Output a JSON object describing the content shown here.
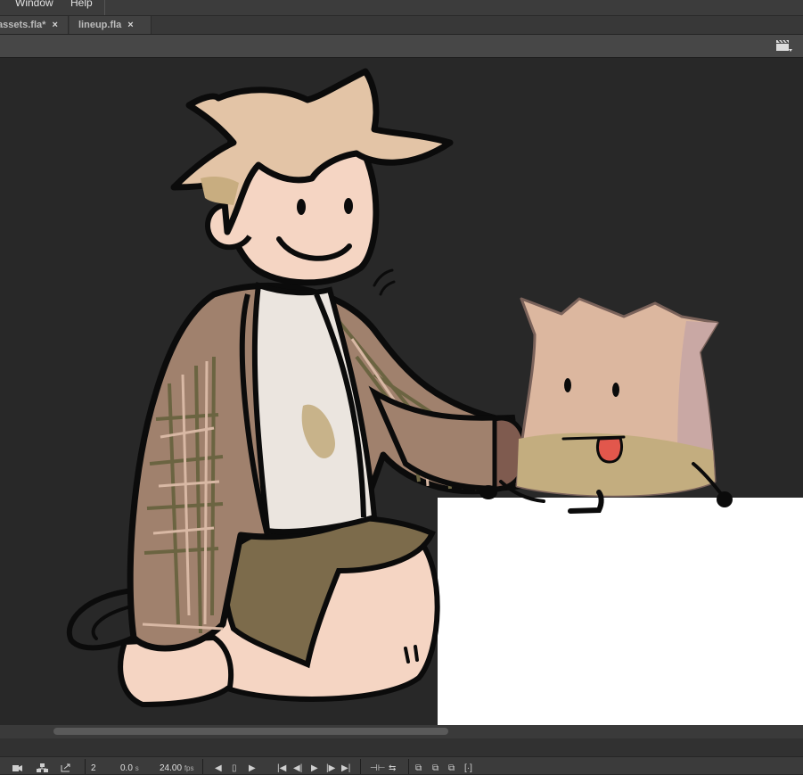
{
  "menu": {
    "items": [
      "Window",
      "Help"
    ]
  },
  "tabs": [
    {
      "label": "assets.fla*",
      "close": "×"
    },
    {
      "label": "lineup.fla",
      "close": "×"
    }
  ],
  "toolbar": {
    "clapper_icon": "movie-clapper-icon"
  },
  "timeline_status": {
    "frame": "2",
    "time_value": "0.0",
    "time_unit": "s",
    "fps_value": "24.00",
    "fps_unit": "fps"
  },
  "colors": {
    "stage_bg": "#282828",
    "skin": "#f5d5c3",
    "hair": "#e3c4a6",
    "jacket": "#a0816d",
    "plaid_dark": "#6b6441",
    "plaid_light": "#d8b8a4",
    "shirt": "#ebe5df",
    "shorts": "#7c6b4b",
    "bag": "#dcb79f",
    "bag_side": "#c9a8a4",
    "bag_stain": "#c3ad7f",
    "tongue": "#e2574c",
    "outline": "#0b0b0b"
  }
}
